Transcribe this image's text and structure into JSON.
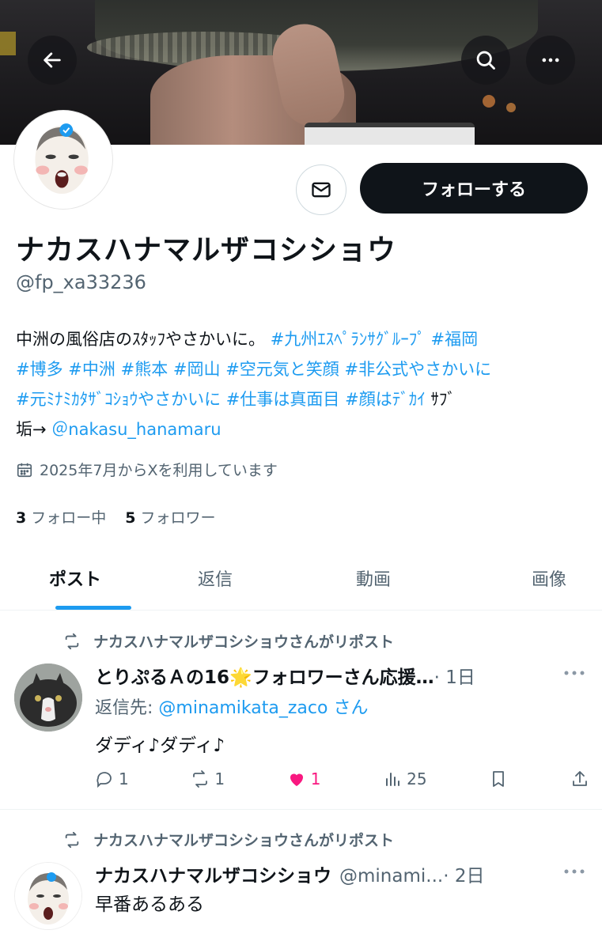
{
  "header": {
    "back_icon": "arrow-left-icon",
    "search_icon": "search-icon",
    "more_icon": "more-horizontal-icon"
  },
  "profile": {
    "display_name": "ナカスハナマルザコシショウ",
    "handle": "@fp_xa33236",
    "follow_label": "フォローする",
    "message_icon": "envelope-icon",
    "bio": {
      "line1_text": "中洲の風俗店のｽﾀｯﾌやさかいに。",
      "line1_tags": [
        "#九州ｴｽﾍﾟﾗﾝｻｸﾞﾙｰﾌﾟ",
        "#福岡"
      ],
      "line2_tags": [
        "#博多",
        "#中洲",
        "#熊本",
        "#岡山",
        "#空元気と笑顔",
        "#非公式やさかいに"
      ],
      "line3_tags": [
        "#元ﾐﾅﾐｶﾀｻﾞｺｼｮｳやさかいに",
        "#仕事は真面目",
        "#顔はﾃﾞｶｲ"
      ],
      "line3_tail": " ｻﾌﾞ",
      "line4_text": "垢→",
      "line4_mention": "＠nakasu_hanamaru"
    },
    "joined": "2025年7月からXを利用しています",
    "following_count": "3",
    "following_label": "フォロー中",
    "followers_count": "5",
    "followers_label": "フォロワー"
  },
  "tabs": [
    {
      "label": "ポスト",
      "active": true
    },
    {
      "label": "返信",
      "active": false
    },
    {
      "label": "動画",
      "active": false
    },
    {
      "label": "画像",
      "active": false
    }
  ],
  "posts": [
    {
      "repost_text": "ナカスハナマルザコシショウさんがリポスト",
      "author": "とりぷるＡの16🌟フォロワーさん応援…",
      "time": "· 1日",
      "reply_prefix": "返信先: ",
      "reply_to": "@minamikata_zaco",
      "reply_suffix": " さん",
      "text": "ダディ♪ダディ♪",
      "replies": "1",
      "reposts": "1",
      "likes": "1",
      "views": "25"
    },
    {
      "repost_text": "ナカスハナマルザコシショウさんがリポスト",
      "author": "ナカスハナマルザコシショウ",
      "handle": "@minami...",
      "time": "· 2日",
      "text": "早番あるある"
    }
  ],
  "colors": {
    "accent": "#1d9bf0",
    "like": "#f91880",
    "text": "#0f1419",
    "muted": "#536471"
  }
}
